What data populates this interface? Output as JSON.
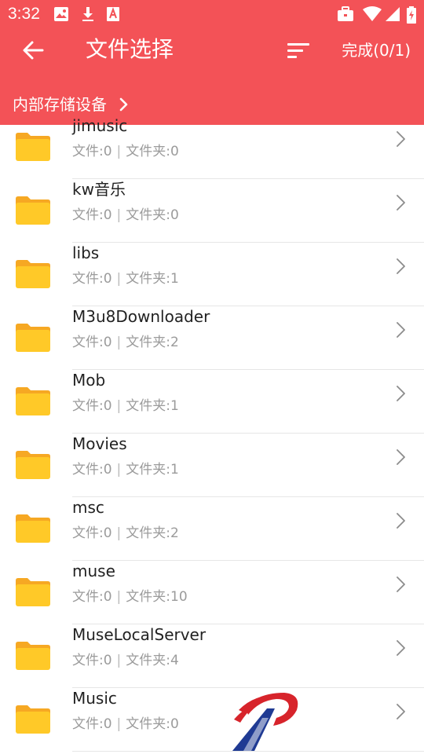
{
  "status_bar": {
    "time": "3:32"
  },
  "toolbar": {
    "title": "文件选择",
    "done_label": "完成(0/1)"
  },
  "breadcrumb": {
    "label": "内部存储设备"
  },
  "colors": {
    "accent": "#f35257",
    "folder": "#ffc928",
    "folder_tab": "#f6a823"
  },
  "files": [
    {
      "name": "jimusic",
      "files_label": "文件:0",
      "folders_label": "文件夹:0"
    },
    {
      "name": "kw音乐",
      "files_label": "文件:0",
      "folders_label": "文件夹:0"
    },
    {
      "name": "libs",
      "files_label": "文件:0",
      "folders_label": "文件夹:1"
    },
    {
      "name": "M3u8Downloader",
      "files_label": "文件:0",
      "folders_label": "文件夹:2"
    },
    {
      "name": "Mob",
      "files_label": "文件:0",
      "folders_label": "文件夹:1"
    },
    {
      "name": "Movies",
      "files_label": "文件:0",
      "folders_label": "文件夹:1"
    },
    {
      "name": "msc",
      "files_label": "文件:0",
      "folders_label": "文件夹:2"
    },
    {
      "name": "muse",
      "files_label": "文件:0",
      "folders_label": "文件夹:10"
    },
    {
      "name": "MuseLocalServer",
      "files_label": "文件:0",
      "folders_label": "文件夹:4"
    },
    {
      "name": "Music",
      "files_label": "文件:0",
      "folders_label": "文件夹:0"
    }
  ]
}
